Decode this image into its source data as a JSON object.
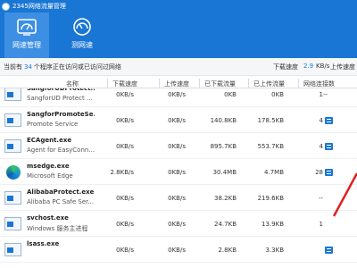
{
  "window": {
    "title": "2345网络流量管理"
  },
  "nav": {
    "tabs": [
      {
        "label": "网速管理",
        "icon": "speed-gauge-icon",
        "active": true
      },
      {
        "label": "测网速",
        "icon": "speed-test-icon",
        "active": false
      }
    ]
  },
  "status": {
    "prefix": "当前有",
    "count": "34",
    "suffix": "个程序正在访问或已访问过网络",
    "download_label": "下载速度",
    "download_value": "2.9",
    "download_unit": "KB/s",
    "upload_label": "上传速度"
  },
  "table": {
    "columns": [
      "名称",
      "下载速度",
      "上传速度",
      "已下载流量",
      "已上传流量",
      "网络连接数"
    ],
    "rows": [
      {
        "name": "SangforUDProtect...",
        "desc": "SangforUD Protect ...",
        "down_speed": "0KB/s",
        "up_speed": "0KB/s",
        "downloaded": "0KB",
        "uploaded": "0KB",
        "connections": "1",
        "limit": "--"
      },
      {
        "name": "SangforPromoteSe...",
        "desc": "Promote Service",
        "down_speed": "0KB/s",
        "up_speed": "0KB/s",
        "downloaded": "140.8KB",
        "uploaded": "178.5KB",
        "connections": "4",
        "limit": ""
      },
      {
        "name": "ECAgent.exe",
        "desc": "Agent for EasyConn...",
        "down_speed": "0KB/s",
        "up_speed": "0KB/s",
        "downloaded": "895.7KB",
        "uploaded": "553.7KB",
        "connections": "4",
        "limit": ""
      },
      {
        "name": "msedge.exe",
        "desc": "Microsoft Edge",
        "down_speed": "2.8KB/s",
        "up_speed": "0KB/s",
        "downloaded": "30.4MB",
        "uploaded": "4.7MB",
        "connections": "28",
        "limit": ""
      },
      {
        "name": "AlibabaProtect.exe",
        "desc": "Alibaba PC Safe Ser...",
        "down_speed": "0KB/s",
        "up_speed": "0KB/s",
        "downloaded": "38.2KB",
        "uploaded": "219.6KB",
        "connections": "--",
        "limit": ""
      },
      {
        "name": "svchost.exe",
        "desc": "Windows 服务主进程",
        "down_speed": "0KB/s",
        "up_speed": "0KB/s",
        "downloaded": "24.7KB",
        "uploaded": "13.9KB",
        "connections": "1",
        "limit": ""
      },
      {
        "name": "lsass.exe",
        "desc": "",
        "down_speed": "0KB/s",
        "up_speed": "0KB/s",
        "downloaded": "2.8KB",
        "uploaded": "3.3KB",
        "connections": "",
        "limit": ""
      }
    ]
  },
  "colors": {
    "brand": "#1a76d4",
    "annotation_arrow": "#e02020"
  }
}
